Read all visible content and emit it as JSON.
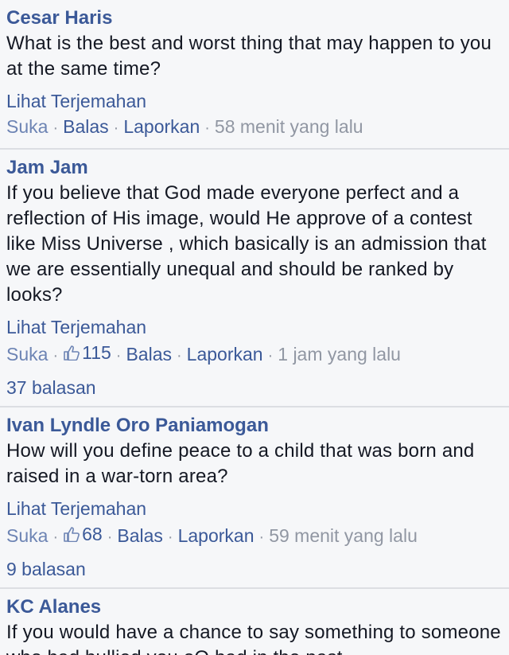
{
  "comments": [
    {
      "author": "Cesar Haris",
      "text": "What is the best and worst thing that may happen to you at the same time?",
      "translate": "Lihat Terjemahan",
      "like": "Suka",
      "reply": "Balas",
      "report": "Laporkan",
      "time": "58 menit yang lalu"
    },
    {
      "author": "Jam Jam",
      "text": "If you believe that God made everyone perfect and a reflection of His image, would He approve of a contest like Miss Universe , which basically is an admission that we are essentially unequal and should be ranked by looks?",
      "translate": "Lihat Terjemahan",
      "like": "Suka",
      "likes": "115",
      "reply": "Balas",
      "report": "Laporkan",
      "time": "1 jam yang lalu",
      "replies": "37 balasan"
    },
    {
      "author": "Ivan Lyndle Oro Paniamogan",
      "text": "How will you define peace to a child that was born and raised in a war-torn area?",
      "translate": "Lihat Terjemahan",
      "like": "Suka",
      "likes": "68",
      "reply": "Balas",
      "report": "Laporkan",
      "time": "59 menit yang lalu",
      "replies": "9 balasan"
    },
    {
      "author": "KC Alanes",
      "text": "If you would have a chance to say something to someone who had bullied you oO bad in the past"
    }
  ],
  "separator": "·",
  "colors": {
    "link": "#3b5998",
    "muted": "#9197a3",
    "background": "#f6f7f9",
    "divider": "#dcdee3"
  },
  "icons": {
    "like_count": "thumbs-up-icon"
  }
}
